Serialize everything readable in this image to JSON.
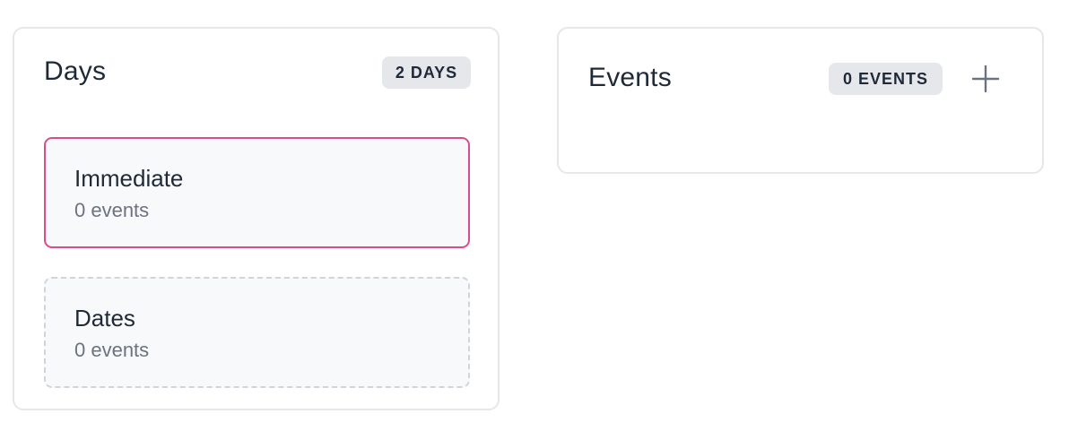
{
  "days_panel": {
    "title": "Days",
    "badge": "2 DAYS",
    "items": [
      {
        "name": "Immediate",
        "count": "0 events",
        "selected": true
      },
      {
        "name": "Dates",
        "count": "0 events",
        "selected": false
      }
    ]
  },
  "events_panel": {
    "title": "Events",
    "badge": "0 EVENTS",
    "add_icon": "plus-icon"
  },
  "colors": {
    "selected_border": "#db4c8d",
    "badge_bg": "#e5e7eb",
    "card_bg": "#f8f9fb",
    "muted_text": "#6b7280"
  }
}
